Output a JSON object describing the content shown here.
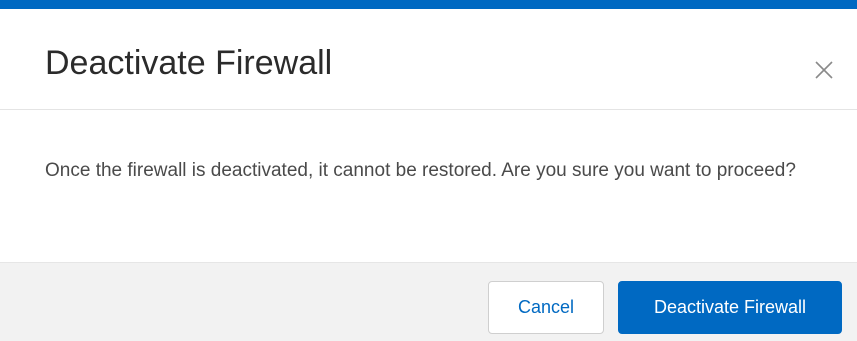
{
  "dialog": {
    "title": "Deactivate Firewall",
    "message": "Once the firewall is deactivated, it cannot be restored. Are you sure you want to proceed?",
    "close_icon": "close-icon"
  },
  "footer": {
    "cancel_label": "Cancel",
    "confirm_label": "Deactivate Firewall"
  },
  "colors": {
    "accent": "#0069c2",
    "footer_bg": "#f2f2f2",
    "title_text": "#2b2b2b",
    "body_text": "#4a4a4a"
  }
}
